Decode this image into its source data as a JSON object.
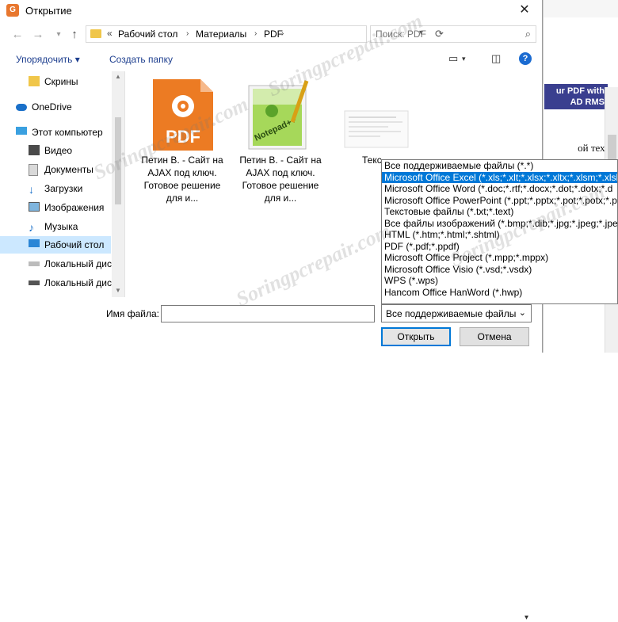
{
  "window": {
    "title": "Открытие",
    "close": "✕"
  },
  "nav": {
    "back_icon": "arrow-left-icon",
    "forward_icon": "arrow-right-icon",
    "up_icon": "arrow-up-icon",
    "breadcrumb_prefix": "«",
    "breadcrumbs": [
      "Рабочий стол",
      "Материалы",
      "PDF"
    ],
    "search_placeholder": "Поиск: PDF"
  },
  "toolbar": {
    "organize": "Упорядочить ▾",
    "new_folder": "Создать папку"
  },
  "sidebar": {
    "items": [
      {
        "label": "Скрины"
      },
      {
        "label": "OneDrive"
      },
      {
        "label": "Этот компьютер"
      },
      {
        "label": "Видео"
      },
      {
        "label": "Документы"
      },
      {
        "label": "Загрузки"
      },
      {
        "label": "Изображения"
      },
      {
        "label": "Музыка"
      },
      {
        "label": "Рабочий стол"
      },
      {
        "label": "Локальный дис"
      },
      {
        "label": "Локальный дис"
      }
    ]
  },
  "files": [
    {
      "caption": "Петин В. - Сайт на AJAX под ключ. Готовое решение для и...",
      "icon": "pdf",
      "icon_text": "PDF"
    },
    {
      "caption": "Петин В. - Сайт на AJAX под ключ. Готовое решение для и...",
      "icon": "notepad-plus-plus",
      "icon_text": "Notepad++"
    },
    {
      "caption": "Текс",
      "icon": "text-document",
      "icon_text": ""
    }
  ],
  "footer": {
    "filename_label": "Имя файла:",
    "filename_value": "",
    "filetype_selected": "Все поддерживаемые файлы",
    "open": "Открыть",
    "cancel": "Отмена"
  },
  "filetype_options": [
    "Все поддерживаемые файлы (*.*)",
    "Microsoft Office Excel (*.xls;*.xlt;*.xlsx;*.xltx;*.xlsm;*.xlsb;",
    "Microsoft Office Word (*.doc;*.rtf;*.docx;*.dot;*.dotx;*.d",
    "Microsoft Office PowerPoint (*.ppt;*.pptx;*.pot;*.potx;*.p",
    "Текстовые файлы (*.txt;*.text)",
    "Все файлы изображений (*.bmp;*.dib;*.jpg;*.jpeg;*.jpe",
    "HTML (*.htm;*.html;*.shtml)",
    "PDF (*.pdf;*.ppdf)",
    "Microsoft Office Project (*.mpp;*.mppx)",
    "Microsoft Office Visio (*.vsd;*.vsdx)",
    "WPS (*.wps)",
    "Hancom Office HanWord (*.hwp)"
  ],
  "filetype_highlighted_index": 1,
  "background_app": {
    "banner": "ur PDF with AD RMS",
    "text": "ой тех-"
  },
  "watermark": "Soringpcrepair.com",
  "colors": {
    "accent": "#0078d7",
    "selected_nav": "#cce8ff",
    "pdf_orange": "#ec7b23"
  }
}
